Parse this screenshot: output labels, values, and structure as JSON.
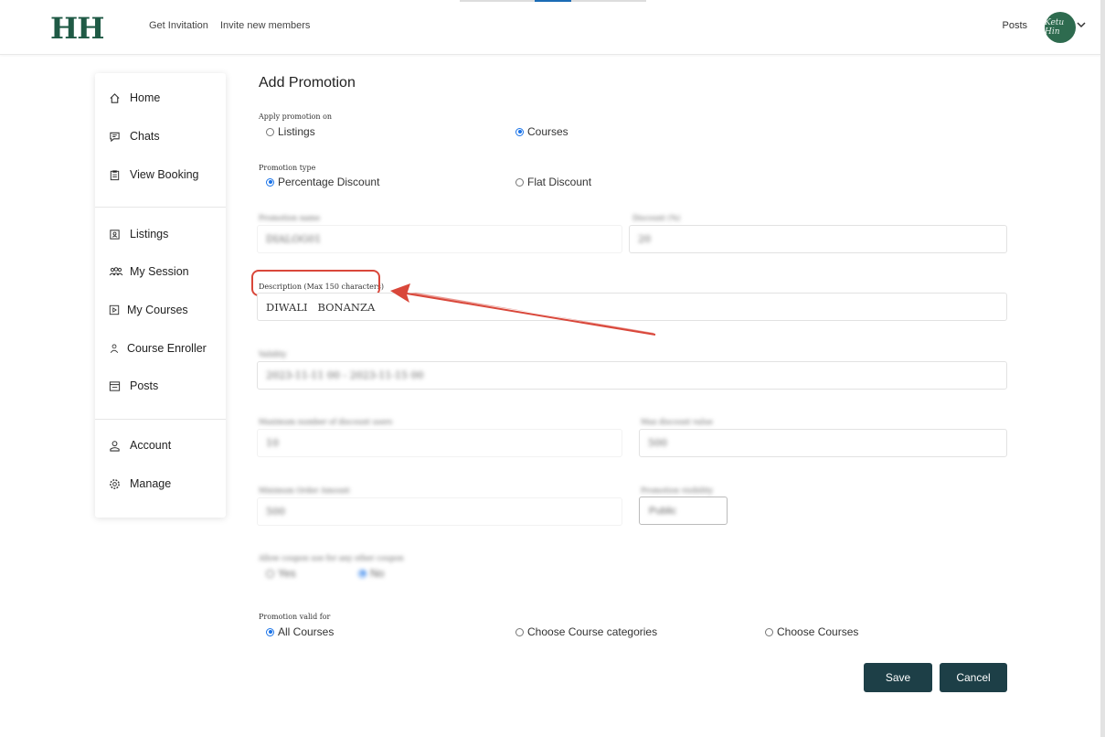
{
  "header": {
    "logo": "HH",
    "nav": [
      "Get Invitation",
      "Invite new members"
    ],
    "posts": "Posts",
    "avatar_text": "Ketu Hin"
  },
  "sidebar": {
    "items": [
      {
        "label": "Home",
        "icon": "home-icon"
      },
      {
        "label": "Chats",
        "icon": "chat-icon"
      },
      {
        "label": "View Booking",
        "icon": "clipboard-icon"
      },
      {
        "label": "Listings",
        "icon": "listing-icon"
      },
      {
        "label": "My Session",
        "icon": "group-icon"
      },
      {
        "label": "My Courses",
        "icon": "play-icon"
      },
      {
        "label": "Course Enroller",
        "icon": "user-icon"
      },
      {
        "label": "Posts",
        "icon": "posts-icon"
      },
      {
        "label": "Account",
        "icon": "account-icon"
      },
      {
        "label": "Manage",
        "icon": "gear-icon"
      }
    ]
  },
  "form": {
    "title": "Add Promotion",
    "apply_on": {
      "label": "Apply promotion on",
      "options": [
        "Listings",
        "Courses"
      ],
      "selected": "Courses"
    },
    "type": {
      "label": "Promotion type",
      "options": [
        "Percentage Discount",
        "Flat Discount"
      ],
      "selected": "Percentage Discount"
    },
    "promotion_name": {
      "label": "Promotion name",
      "value": "DIALOG01"
    },
    "discount": {
      "label": "Discount (%)",
      "value": "20"
    },
    "description": {
      "label": "Description (Max 150 characters)",
      "value": "DIWALI   BONANZA"
    },
    "validity": {
      "label": "Validity",
      "value": "2023-11-11 00 - 2023-11-15 00"
    },
    "max_usage": {
      "label": "Maximum number of discount users",
      "value": "10"
    },
    "max_discount": {
      "label": "Max discount value",
      "value": "500"
    },
    "min_order": {
      "label": "Minimum Order Amount",
      "value": "500"
    },
    "visibility": {
      "label": "Promotion visibility",
      "value": "Public"
    },
    "allow_other": {
      "label": "Allow coupon use for any other coupon",
      "options": [
        "Yes",
        "No"
      ],
      "selected": "No"
    },
    "valid_for": {
      "label": "Promotion valid for",
      "options": [
        "All Courses",
        "Choose Course categories",
        "Choose Courses"
      ],
      "selected": "All Courses"
    },
    "save": "Save",
    "cancel": "Cancel"
  },
  "colors": {
    "brand": "#1f5a45",
    "button": "#1d3f47",
    "highlight": "#d9473a",
    "radio": "#1a73e8"
  }
}
